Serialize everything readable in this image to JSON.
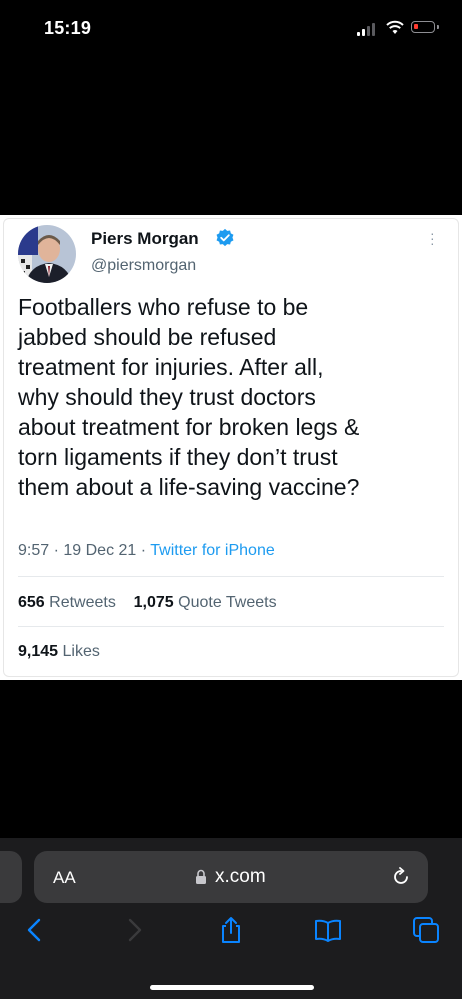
{
  "status_bar": {
    "time": "15:19"
  },
  "tweet": {
    "author_name": "Piers Morgan",
    "handle": "@piersmorgan",
    "text": "Footballers who refuse to be\njabbed should be refused\ntreatment for injuries. After all,\nwhy should they trust doctors\nabout treatment for broken legs &\ntorn ligaments if they don’t trust\nthem about a life-saving vaccine?",
    "time": "9:57",
    "date": "19 Dec 21",
    "source": "Twitter for iPhone",
    "retweets_count": "656",
    "retweets_label": "Retweets",
    "quotes_count": "1,075",
    "quotes_label": "Quote Tweets",
    "likes_count": "9,145",
    "likes_label": "Likes"
  },
  "browser": {
    "text_size_label": "AA",
    "url": "x.com"
  },
  "colors": {
    "accent": "#1d9bf0",
    "battery_low": "#ff3b30",
    "toolbar_icon": "#0a84ff"
  },
  "icons": [
    "signal-icon",
    "wifi-icon",
    "battery-icon",
    "verified-badge-icon",
    "more-icon",
    "lock-icon",
    "reload-icon",
    "back-icon",
    "forward-icon",
    "share-icon",
    "bookmarks-icon",
    "tabs-icon"
  ]
}
